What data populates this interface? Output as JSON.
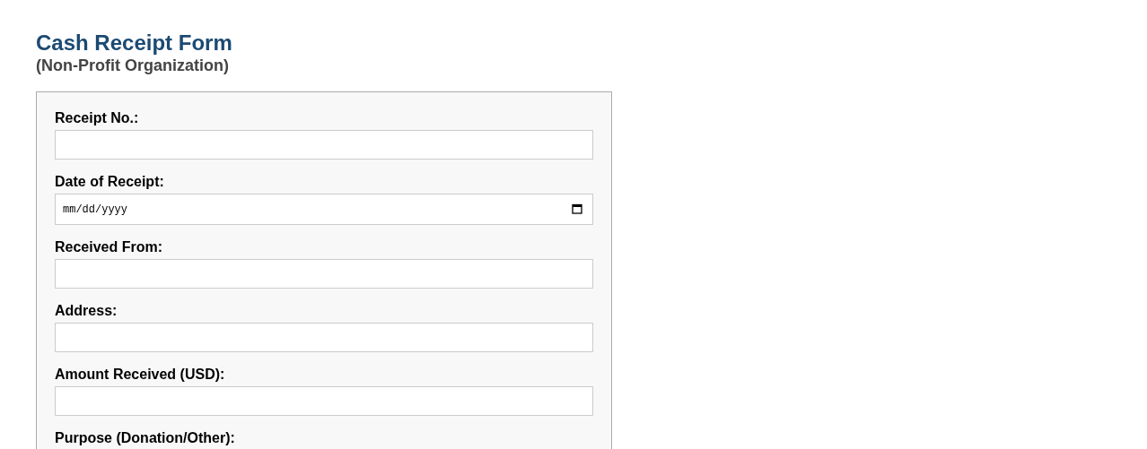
{
  "title": "Cash Receipt Form",
  "subtitle": "(Non-Profit Organization)",
  "fields": [
    {
      "label": "Receipt No.:",
      "kind": "text"
    },
    {
      "label": "Date of Receipt:",
      "kind": "date",
      "placeholder": "mm/dd/yyyy"
    },
    {
      "label": "Received From:",
      "kind": "text"
    },
    {
      "label": "Address:",
      "kind": "text"
    },
    {
      "label": "Amount Received (USD):",
      "kind": "text"
    },
    {
      "label": "Purpose (Donation/Other):"
    }
  ]
}
